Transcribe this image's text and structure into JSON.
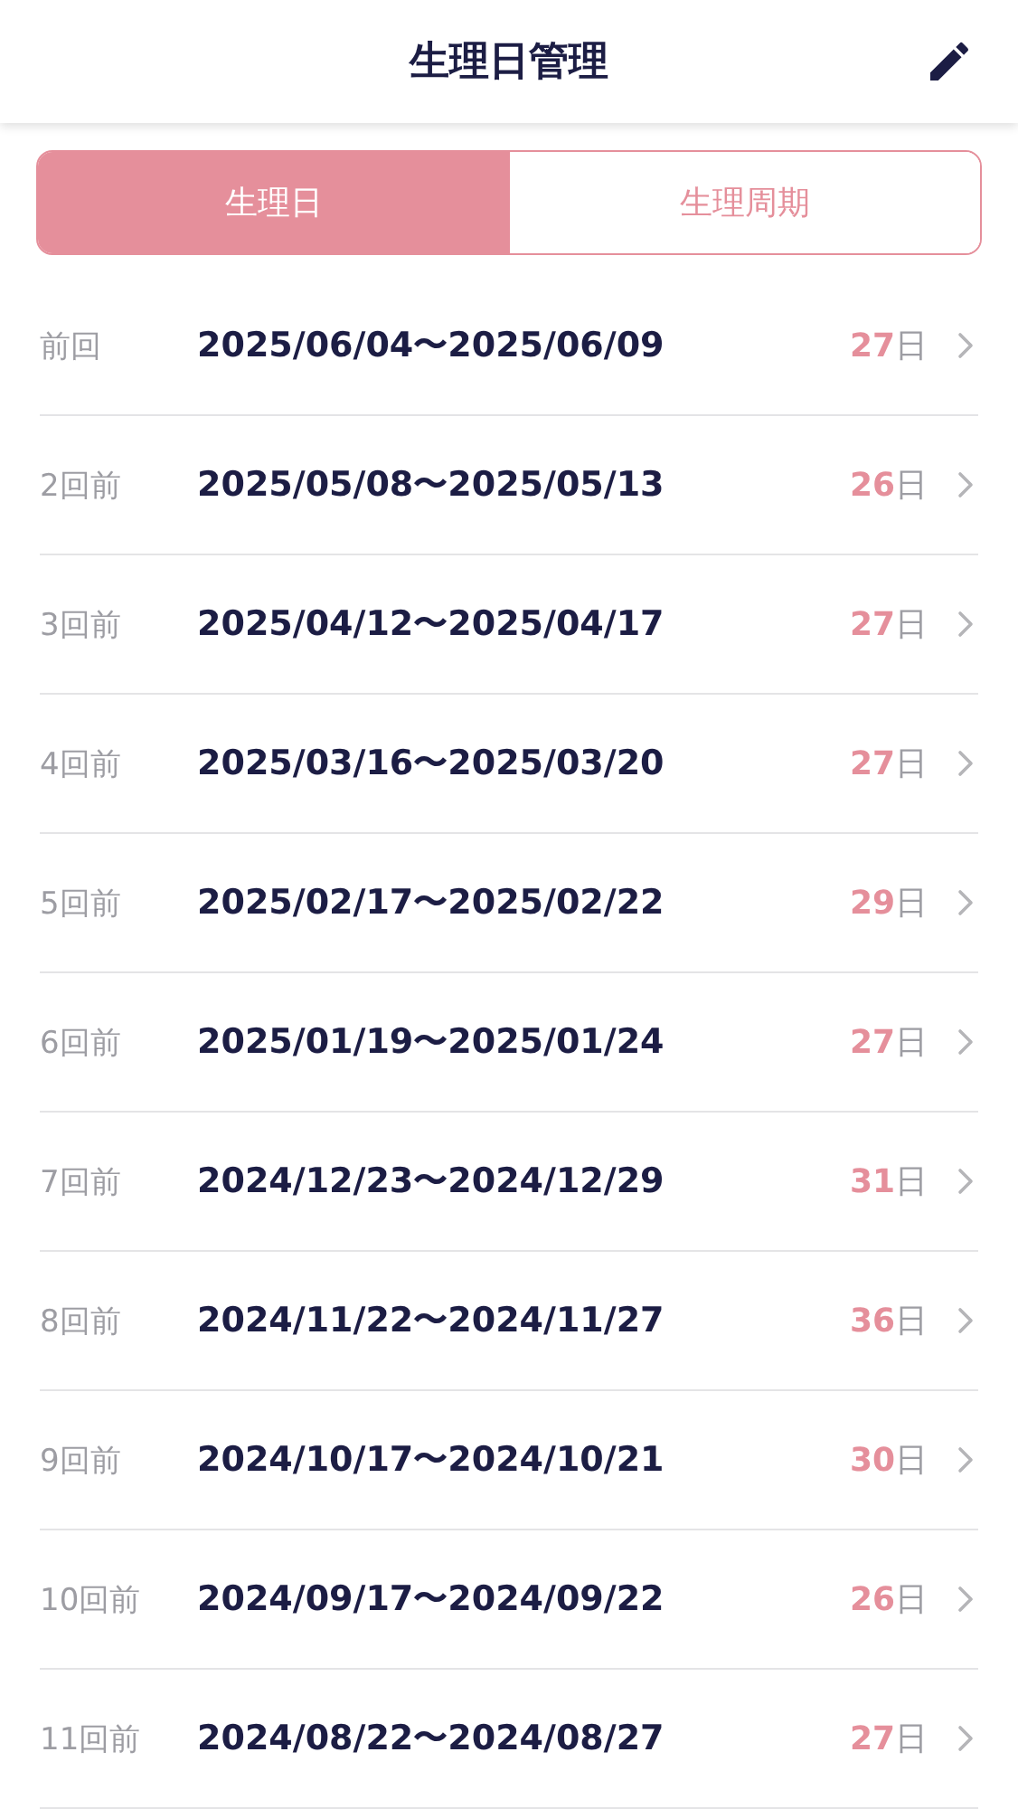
{
  "header": {
    "title": "生理日管理"
  },
  "tabs": [
    {
      "label": "生理日",
      "selected": true
    },
    {
      "label": "生理周期",
      "selected": false
    }
  ],
  "periods": [
    {
      "label": "前回",
      "range": "2025/06/04〜2025/06/09",
      "days": "27",
      "unit": "日"
    },
    {
      "label": "2回前",
      "range": "2025/05/08〜2025/05/13",
      "days": "26",
      "unit": "日"
    },
    {
      "label": "3回前",
      "range": "2025/04/12〜2025/04/17",
      "days": "27",
      "unit": "日"
    },
    {
      "label": "4回前",
      "range": "2025/03/16〜2025/03/20",
      "days": "27",
      "unit": "日"
    },
    {
      "label": "5回前",
      "range": "2025/02/17〜2025/02/22",
      "days": "29",
      "unit": "日"
    },
    {
      "label": "6回前",
      "range": "2025/01/19〜2025/01/24",
      "days": "27",
      "unit": "日"
    },
    {
      "label": "7回前",
      "range": "2024/12/23〜2024/12/29",
      "days": "31",
      "unit": "日"
    },
    {
      "label": "8回前",
      "range": "2024/11/22〜2024/11/27",
      "days": "36",
      "unit": "日"
    },
    {
      "label": "9回前",
      "range": "2024/10/17〜2024/10/21",
      "days": "30",
      "unit": "日"
    },
    {
      "label": "10回前",
      "range": "2024/09/17〜2024/09/22",
      "days": "26",
      "unit": "日"
    },
    {
      "label": "11回前",
      "range": "2024/08/22〜2024/08/27",
      "days": "27",
      "unit": "日"
    }
  ]
}
